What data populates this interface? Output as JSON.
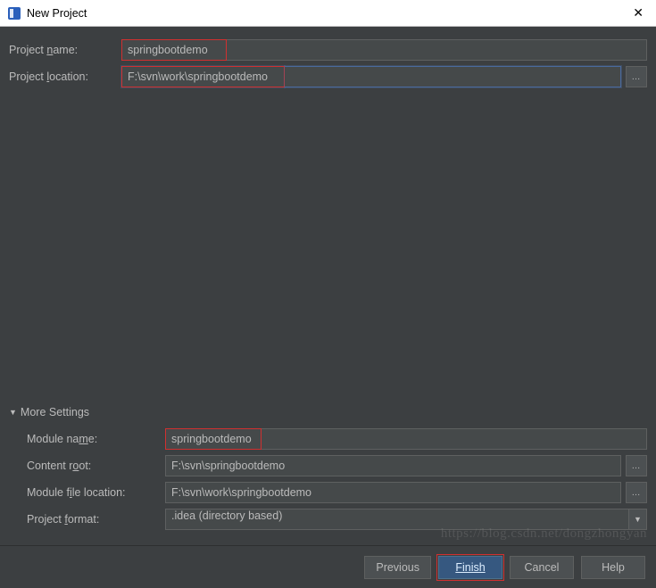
{
  "window": {
    "title": "New Project"
  },
  "top": {
    "projectNameLabel": "Project name:",
    "projectName": "springbootdemo",
    "projectLocationLabel": "Project location:",
    "projectLocation": "F:\\svn\\work\\springbootdemo"
  },
  "more": {
    "header": "More Settings",
    "moduleNameLabel": "Module name:",
    "moduleName": "springbootdemo",
    "contentRootLabel": "Content root:",
    "contentRoot": "F:\\svn\\springbootdemo",
    "moduleFileLocationLabel": "Module file location:",
    "moduleFileLocation": "F:\\svn\\work\\springbootdemo",
    "projectFormatLabel": "Project format:",
    "projectFormat": ".idea (directory based)"
  },
  "buttons": {
    "previous": "Previous",
    "finish": "Finish",
    "cancel": "Cancel",
    "help": "Help"
  },
  "watermark": "https://blog.csdn.net/dongzhongyan"
}
